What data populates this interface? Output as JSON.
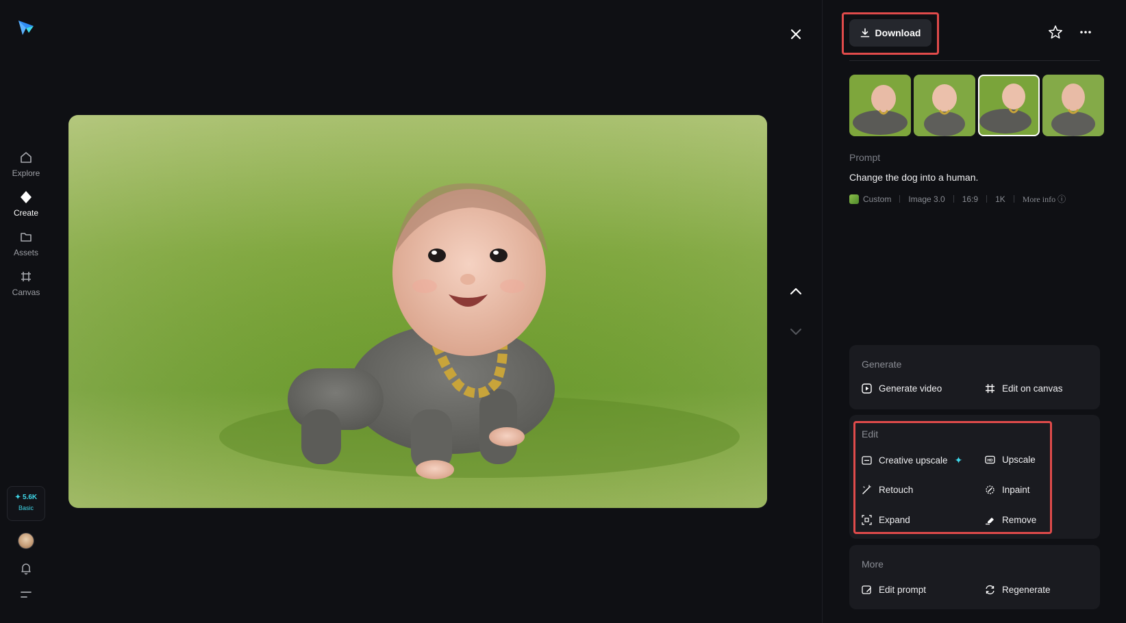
{
  "sidebar": {
    "items": [
      {
        "label": "Explore",
        "icon": "home-icon"
      },
      {
        "label": "Create",
        "icon": "diamond-icon"
      },
      {
        "label": "Assets",
        "icon": "folder-icon"
      },
      {
        "label": "Canvas",
        "icon": "crop-icon"
      }
    ],
    "credits_amount": "✦ 5.6K",
    "credits_plan": "Basic"
  },
  "panel": {
    "download_label": "Download",
    "prompt_label": "Prompt",
    "prompt_text": "Change the dog into a human.",
    "meta": {
      "style": "Custom",
      "model": "Image 3.0",
      "ratio": "16:9",
      "resolution": "1K",
      "more_info": "More info ⓘ"
    },
    "thumbnails_selected_index": 2,
    "generate": {
      "title": "Generate",
      "generate_video": "Generate video",
      "edit_on_canvas": "Edit on canvas"
    },
    "edit": {
      "title": "Edit",
      "creative_upscale": "Creative upscale",
      "upscale": "Upscale",
      "retouch": "Retouch",
      "inpaint": "Inpaint",
      "expand": "Expand",
      "remove": "Remove"
    },
    "more": {
      "title": "More",
      "edit_prompt": "Edit prompt",
      "regenerate": "Regenerate"
    }
  },
  "colors": {
    "background": "#0f1014",
    "card": "#1a1b20",
    "accent": "#3fd8ea",
    "highlight": "#e14b4b"
  }
}
